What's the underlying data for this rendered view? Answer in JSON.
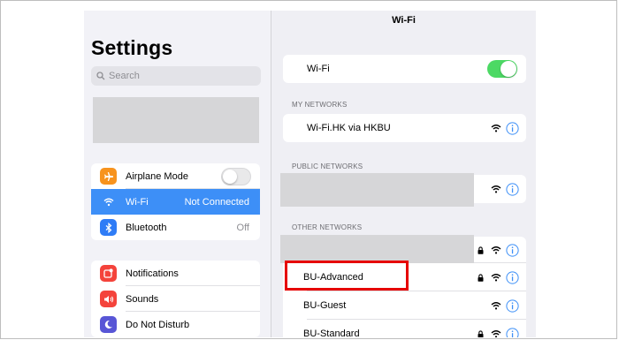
{
  "settings": {
    "title": "Settings",
    "search_placeholder": "Search",
    "connectivity": [
      {
        "label": "Airplane Mode",
        "value": "",
        "icon": "airplane-icon",
        "color": "#f7931e"
      },
      {
        "label": "Wi-Fi",
        "value": "Not Connected",
        "icon": "wifi-icon",
        "color": "#3d8ff7"
      },
      {
        "label": "Bluetooth",
        "value": "Off",
        "icon": "bluetooth-icon",
        "color": "#2f7cf6"
      }
    ],
    "general": [
      {
        "label": "Notifications",
        "icon": "notifications-icon",
        "color": "#f4433b"
      },
      {
        "label": "Sounds",
        "icon": "sounds-icon",
        "color": "#f4433b"
      },
      {
        "label": "Do Not Disturb",
        "icon": "moon-icon",
        "color": "#5856d6"
      }
    ]
  },
  "wifi": {
    "nav_title": "Wi-Fi",
    "toggle_label": "Wi-Fi",
    "toggle_on": true,
    "my_networks_header": "MY NETWORKS",
    "my_networks": [
      {
        "name": "Wi-Fi.HK via HKBU"
      }
    ],
    "public_networks_header": "PUBLIC NETWORKS",
    "other_networks_header": "OTHER NETWORKS",
    "other_networks": [
      {
        "name": "BU-Advanced",
        "locked": true
      },
      {
        "name": "BU-Guest",
        "locked": false
      },
      {
        "name": "BU-Standard",
        "locked": true
      }
    ]
  },
  "colors": {
    "accent": "#3d8ff7",
    "toggle_on": "#4cd964",
    "highlight": "#e60000"
  }
}
